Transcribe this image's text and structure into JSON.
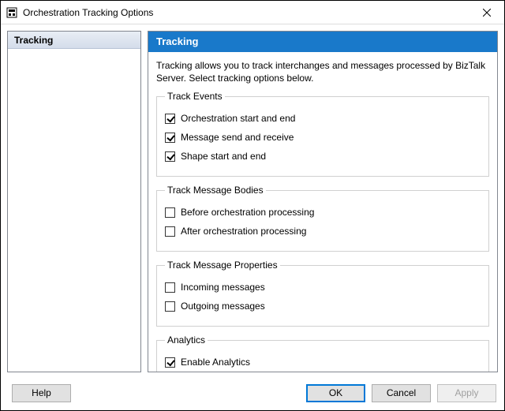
{
  "window": {
    "title": "Orchestration Tracking Options"
  },
  "nav": {
    "items": [
      {
        "label": "Tracking"
      }
    ]
  },
  "panel": {
    "header": "Tracking",
    "description": "Tracking allows you to track interchanges and messages processed by BizTalk Server. Select tracking options below.",
    "groups": {
      "events": {
        "legend": "Track Events",
        "opts": [
          {
            "label": "Orchestration start and end",
            "checked": true
          },
          {
            "label": "Message send and receive",
            "checked": true
          },
          {
            "label": "Shape start and end",
            "checked": true
          }
        ]
      },
      "bodies": {
        "legend": "Track Message Bodies",
        "opts": [
          {
            "label": "Before orchestration processing",
            "checked": false
          },
          {
            "label": "After orchestration processing",
            "checked": false
          }
        ]
      },
      "props": {
        "legend": "Track Message Properties",
        "opts": [
          {
            "label": "Incoming messages",
            "checked": false
          },
          {
            "label": "Outgoing messages",
            "checked": false
          }
        ]
      },
      "analytics": {
        "legend": "Analytics",
        "opts": [
          {
            "label": "Enable Analytics",
            "checked": true
          }
        ]
      }
    }
  },
  "buttons": {
    "help": "Help",
    "ok": "OK",
    "cancel": "Cancel",
    "apply": "Apply"
  }
}
